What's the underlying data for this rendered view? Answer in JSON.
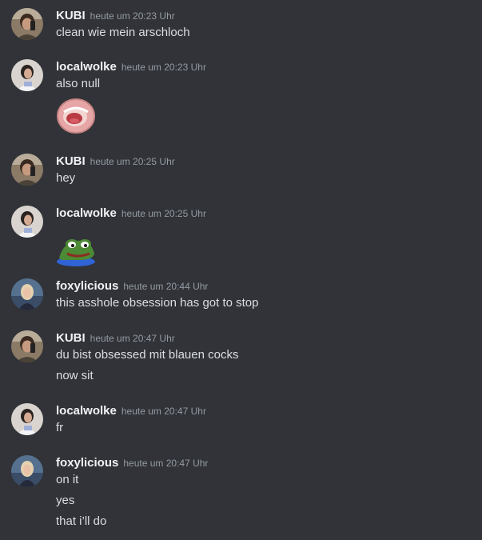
{
  "colors": {
    "background": "#313338",
    "username": "#f2f3f5",
    "timestamp": "#949ba4",
    "message_text": "#dbdee1"
  },
  "messages": [
    {
      "author": "KUBI",
      "avatar": "avatar-kubi",
      "timestamp": "heute um 20:23 Uhr",
      "lines": [
        "clean wie mein arschloch"
      ]
    },
    {
      "author": "localwolke",
      "avatar": "avatar-localwolke",
      "timestamp": "heute um 20:23 Uhr",
      "lines": [
        "also null"
      ],
      "emoji": "open-mouth-emoji"
    },
    {
      "author": "KUBI",
      "avatar": "avatar-kubi",
      "timestamp": "heute um 20:25 Uhr",
      "lines": [
        "hey"
      ]
    },
    {
      "author": "localwolke",
      "avatar": "avatar-localwolke",
      "timestamp": "heute um 20:25 Uhr",
      "lines": [],
      "emoji": "pepe-frog-emoji"
    },
    {
      "author": "foxylicious",
      "avatar": "avatar-foxylicious",
      "timestamp": "heute um 20:44 Uhr",
      "lines": [
        "this asshole obsession has got to stop"
      ]
    },
    {
      "author": "KUBI",
      "avatar": "avatar-kubi",
      "timestamp": "heute um 20:47 Uhr",
      "lines": [
        "du bist obsessed mit blauen cocks",
        "now sit"
      ]
    },
    {
      "author": "localwolke",
      "avatar": "avatar-localwolke",
      "timestamp": "heute um 20:47 Uhr",
      "lines": [
        "fr"
      ]
    },
    {
      "author": "foxylicious",
      "avatar": "avatar-foxylicious",
      "timestamp": "heute um 20:47 Uhr",
      "lines": [
        "on it",
        "yes",
        "that i’ll do"
      ]
    }
  ]
}
